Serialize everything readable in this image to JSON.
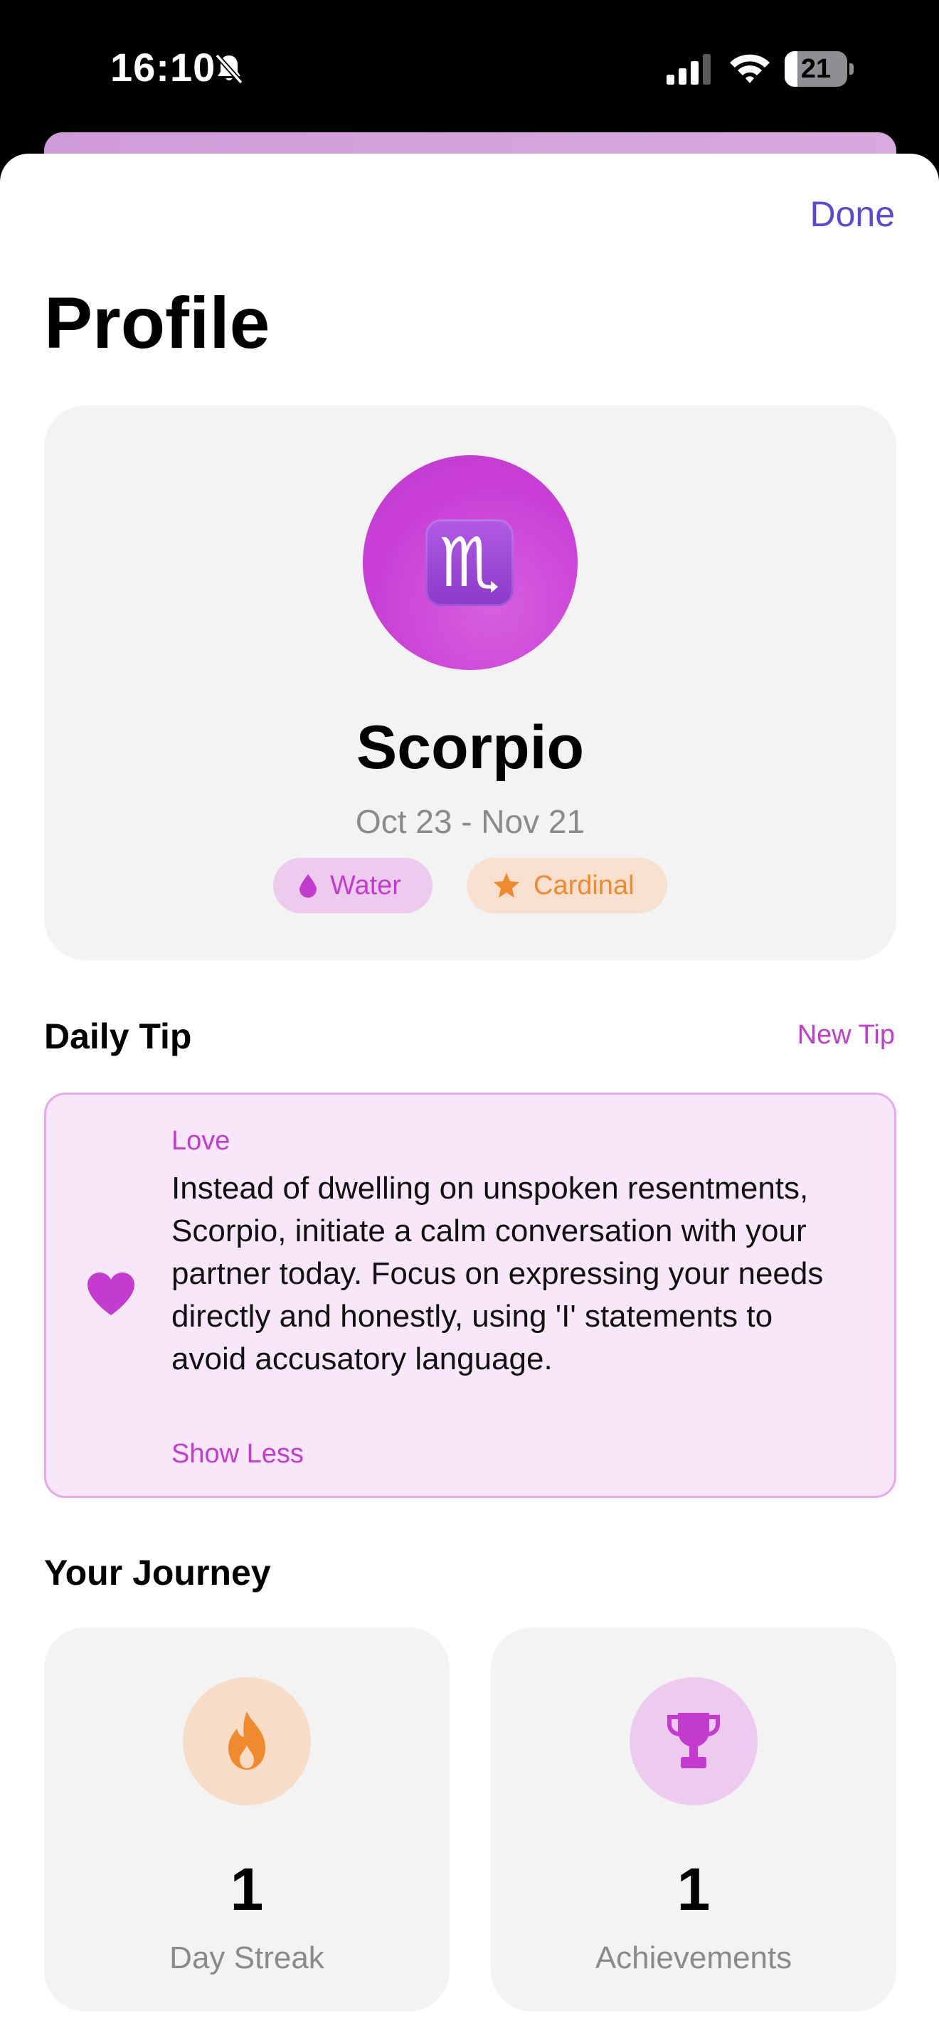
{
  "status_bar": {
    "time": "16:10",
    "battery_level": "21",
    "battery_fraction": 0.21
  },
  "header": {
    "done_label": "Done",
    "title": "Profile"
  },
  "sign": {
    "symbol": "♏",
    "name": "Scorpio",
    "dates": "Oct 23 - Nov 21",
    "element": "Water",
    "modality": "Cardinal"
  },
  "daily_tip": {
    "section_title": "Daily Tip",
    "new_tip_label": "New Tip",
    "category": "Love",
    "text": "Instead of dwelling on unspoken resentments, Scorpio, initiate a calm conversation with your partner today.  Focus on expressing your needs directly and honestly, using 'I' statements to avoid accusatory language.",
    "toggle_label": "Show Less"
  },
  "journey": {
    "section_title": "Your Journey",
    "streak_value": "1",
    "streak_label": "Day Streak",
    "achievements_value": "1",
    "achievements_label": "Achievements"
  },
  "colors": {
    "accent": "#c33ccf",
    "done": "#5b4ad8",
    "orange": "#ef8a2e"
  },
  "icons": {
    "bell": "bell-slash-icon",
    "signal": "cellular-signal-icon",
    "wifi": "wifi-icon",
    "battery": "battery-icon",
    "water": "drop-icon",
    "cardinal": "star-icon",
    "tip": "heart-icon",
    "streak": "flame-icon",
    "achievements": "trophy-icon"
  }
}
